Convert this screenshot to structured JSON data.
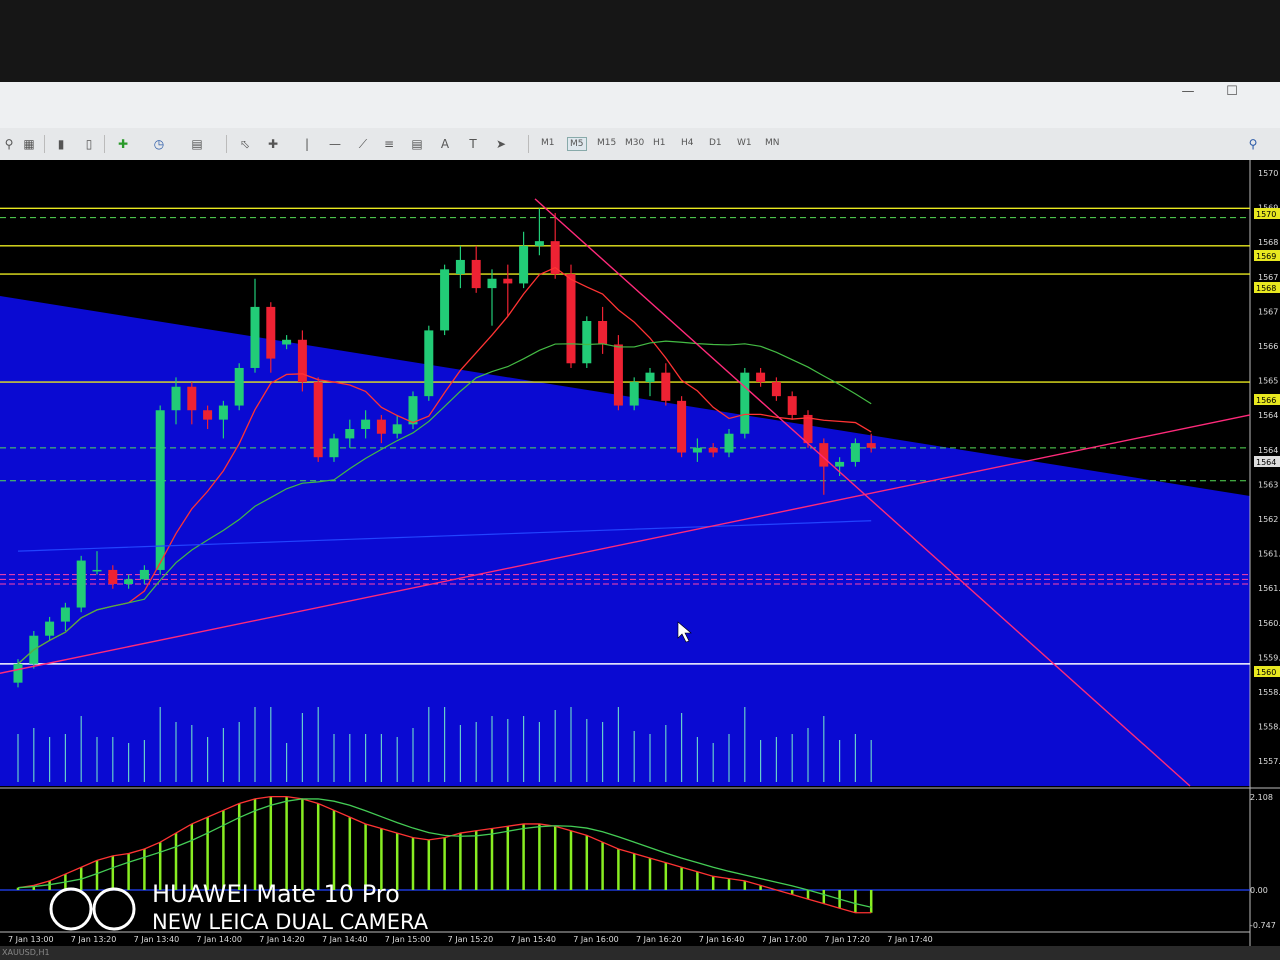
{
  "toolbar": {
    "timeframes": [
      "M1",
      "M5",
      "M15",
      "M30",
      "H1",
      "H4",
      "D1",
      "W1",
      "MN"
    ],
    "active_timeframe": "M5",
    "icons": [
      "zoom-icon",
      "tile-windows-icon",
      "bar-chart-icon",
      "candles-icon",
      "new-order-icon",
      "clock-icon",
      "template-icon",
      "cursor-icon",
      "crosshair-icon",
      "vertical-line-icon",
      "horizontal-line-icon",
      "trendline-icon",
      "fibonacci-icon",
      "channel-icon",
      "text-icon",
      "text-label-icon",
      "arrows-icon",
      "search-icon"
    ]
  },
  "window_controls": {
    "minimize": "—",
    "maximize": "☐"
  },
  "chart": {
    "symbol_tab": "XAUUSD,H1",
    "price_axis": [
      "1570",
      "1569",
      "1568",
      "1567",
      "1567",
      "1566",
      "1565",
      "1564",
      "1564",
      "1563",
      "1562",
      "1561.9",
      "1561.2",
      "1560.4",
      "1559.7",
      "1558.9",
      "1558.2",
      "1557.4"
    ],
    "price_tags": [
      "1570",
      "1569",
      "1568",
      "1566",
      "1564",
      "1560"
    ],
    "time_axis": [
      "7 Jan 13:00",
      "7 Jan 13:20",
      "7 Jan 13:40",
      "7 Jan 14:00",
      "7 Jan 14:20",
      "7 Jan 14:40",
      "7 Jan 15:00",
      "7 Jan 15:20",
      "7 Jan 15:40",
      "7 Jan 16:00",
      "7 Jan 16:20",
      "7 Jan 16:40",
      "7 Jan 17:00",
      "7 Jan 17:20",
      "7 Jan 17:40"
    ],
    "colors": {
      "background": "#000000",
      "shaded_area": "#0a0ad2",
      "bull": "#22cc77",
      "bear": "#ee2233",
      "level": "#e8e820",
      "trend": "#ff2a7a",
      "ma_fast": "#ff3333",
      "ma_slow": "#44bb44"
    }
  },
  "chart_data": {
    "type": "candlestick",
    "series": [
      {
        "name": "price",
        "values": [
          [
            1559.6,
            1560.1,
            1559.5,
            1560.0
          ],
          [
            1560.0,
            1560.7,
            1559.9,
            1560.6
          ],
          [
            1560.6,
            1561.0,
            1560.5,
            1560.9
          ],
          [
            1560.9,
            1561.3,
            1560.7,
            1561.2
          ],
          [
            1561.2,
            1562.3,
            1561.1,
            1562.2
          ],
          [
            1562.0,
            1562.4,
            1561.9,
            1562.0
          ],
          [
            1562.0,
            1562.1,
            1561.6,
            1561.7
          ],
          [
            1561.7,
            1561.9,
            1561.6,
            1561.8
          ],
          [
            1561.8,
            1562.1,
            1561.7,
            1562.0
          ],
          [
            1562.0,
            1565.5,
            1561.9,
            1565.4
          ],
          [
            1565.4,
            1566.1,
            1565.1,
            1565.9
          ],
          [
            1565.9,
            1566.0,
            1565.1,
            1565.4
          ],
          [
            1565.4,
            1565.5,
            1565.0,
            1565.2
          ],
          [
            1565.2,
            1565.6,
            1564.8,
            1565.5
          ],
          [
            1565.5,
            1566.4,
            1565.4,
            1566.3
          ],
          [
            1566.3,
            1568.2,
            1566.2,
            1567.6
          ],
          [
            1567.6,
            1567.7,
            1566.2,
            1566.5
          ],
          [
            1566.8,
            1567.0,
            1566.7,
            1566.9
          ],
          [
            1566.9,
            1567.1,
            1565.8,
            1566.0
          ],
          [
            1566.0,
            1566.1,
            1564.3,
            1564.4
          ],
          [
            1564.4,
            1564.9,
            1564.3,
            1564.8
          ],
          [
            1564.8,
            1565.2,
            1564.6,
            1565.0
          ],
          [
            1565.0,
            1565.4,
            1564.8,
            1565.2
          ],
          [
            1565.2,
            1565.3,
            1564.7,
            1564.9
          ],
          [
            1564.9,
            1565.3,
            1564.8,
            1565.1
          ],
          [
            1565.1,
            1565.8,
            1565.0,
            1565.7
          ],
          [
            1565.7,
            1567.2,
            1565.6,
            1567.1
          ],
          [
            1567.1,
            1568.5,
            1567.0,
            1568.4
          ],
          [
            1568.3,
            1568.9,
            1568.0,
            1568.6
          ],
          [
            1568.6,
            1568.9,
            1567.9,
            1568.0
          ],
          [
            1568.0,
            1568.4,
            1567.2,
            1568.2
          ],
          [
            1568.2,
            1568.5,
            1567.4,
            1568.1
          ],
          [
            1568.1,
            1569.2,
            1568.0,
            1568.9
          ],
          [
            1568.9,
            1569.7,
            1568.7,
            1569.0
          ],
          [
            1569.0,
            1569.6,
            1568.2,
            1568.3
          ],
          [
            1568.3,
            1568.5,
            1566.3,
            1566.4
          ],
          [
            1566.4,
            1567.4,
            1566.3,
            1567.3
          ],
          [
            1567.3,
            1567.6,
            1566.6,
            1566.8
          ],
          [
            1566.8,
            1567.0,
            1565.4,
            1565.5
          ],
          [
            1565.5,
            1566.1,
            1565.4,
            1566.0
          ],
          [
            1566.0,
            1566.3,
            1565.7,
            1566.2
          ],
          [
            1566.2,
            1566.4,
            1565.5,
            1565.6
          ],
          [
            1565.6,
            1565.7,
            1564.4,
            1564.5
          ],
          [
            1564.5,
            1564.8,
            1564.3,
            1564.6
          ],
          [
            1564.6,
            1564.7,
            1564.4,
            1564.5
          ],
          [
            1564.5,
            1565.0,
            1564.4,
            1564.9
          ],
          [
            1564.9,
            1566.3,
            1564.8,
            1566.2
          ],
          [
            1566.2,
            1566.3,
            1565.9,
            1566.0
          ],
          [
            1566.0,
            1566.1,
            1565.6,
            1565.7
          ],
          [
            1565.7,
            1565.8,
            1565.2,
            1565.3
          ],
          [
            1565.3,
            1565.4,
            1564.6,
            1564.7
          ],
          [
            1564.7,
            1564.8,
            1563.6,
            1564.2
          ],
          [
            1564.2,
            1564.4,
            1564.0,
            1564.3
          ],
          [
            1564.3,
            1564.8,
            1564.2,
            1564.7
          ],
          [
            1564.7,
            1564.9,
            1564.5,
            1564.6
          ]
        ]
      }
    ],
    "horizontal_levels": [
      1569.7,
      1568.9,
      1568.3,
      1566.0,
      1560.0
    ],
    "ylim": [
      1557.4,
      1570.6
    ],
    "macd": {
      "values": [
        0.05,
        0.1,
        0.2,
        0.35,
        0.5,
        0.65,
        0.75,
        0.8,
        0.9,
        1.05,
        1.25,
        1.45,
        1.6,
        1.75,
        1.9,
        2.0,
        2.05,
        2.05,
        2.0,
        1.9,
        1.75,
        1.6,
        1.45,
        1.35,
        1.25,
        1.15,
        1.1,
        1.15,
        1.25,
        1.3,
        1.35,
        1.4,
        1.45,
        1.45,
        1.4,
        1.3,
        1.2,
        1.05,
        0.9,
        0.8,
        0.7,
        0.6,
        0.5,
        0.4,
        0.3,
        0.25,
        0.2,
        0.1,
        0.0,
        -0.1,
        -0.2,
        -0.3,
        -0.4,
        -0.5,
        -0.5
      ],
      "ylim": [
        -0.747,
        2.108
      ],
      "axis_labels": [
        "2.108",
        "0.00",
        "-0.747"
      ]
    }
  },
  "watermark": {
    "line1": "HUAWEI Mate 10 Pro",
    "line2": "NEW LEICA DUAL CAMERA"
  }
}
